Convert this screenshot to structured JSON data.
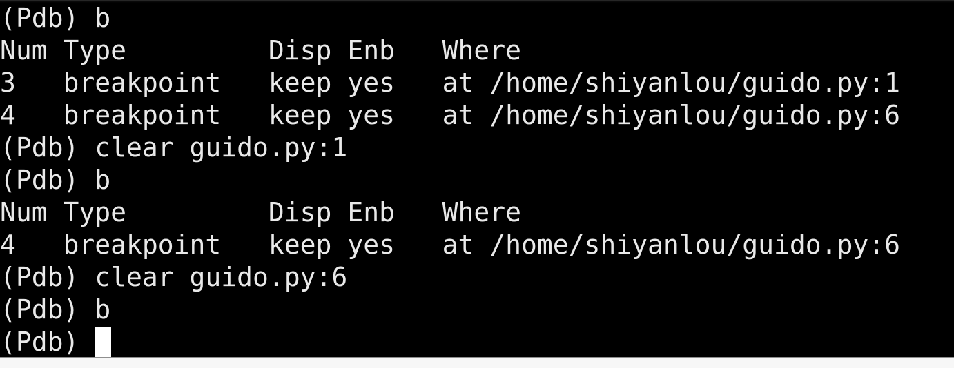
{
  "terminal": {
    "title": "Pdb debugger session",
    "background_color": "#000000",
    "foreground_color": "#e9e9e9",
    "cursor_color": "#ffffff",
    "bottom_bar_color": "#f7f7f7",
    "prompt": "(Pdb) ",
    "cursor": {
      "shape": "block",
      "visible": true,
      "line_index": 10,
      "column": 6
    },
    "lines": [
      {
        "id": "line-1",
        "text": "(Pdb) b",
        "type": "prompt"
      },
      {
        "id": "line-2",
        "text": "Num Type         Disp Enb   Where",
        "type": "header"
      },
      {
        "id": "line-3",
        "text": "3   breakpoint   keep yes   at /home/shiyanlou/guido.py:1",
        "type": "breakpoint"
      },
      {
        "id": "line-4",
        "text": "4   breakpoint   keep yes   at /home/shiyanlou/guido.py:6",
        "type": "breakpoint"
      },
      {
        "id": "line-5",
        "text": "(Pdb) clear guido.py:1",
        "type": "prompt"
      },
      {
        "id": "line-6",
        "text": "(Pdb) b",
        "type": "prompt"
      },
      {
        "id": "line-7",
        "text": "Num Type         Disp Enb   Where",
        "type": "header"
      },
      {
        "id": "line-8",
        "text": "4   breakpoint   keep yes   at /home/shiyanlou/guido.py:6",
        "type": "breakpoint"
      },
      {
        "id": "line-9",
        "text": "(Pdb) clear guido.py:6",
        "type": "prompt"
      },
      {
        "id": "line-10",
        "text": "(Pdb) b",
        "type": "prompt"
      },
      {
        "id": "line-11",
        "text": "(Pdb) ",
        "type": "prompt-cursor"
      }
    ],
    "breakpoint_table": {
      "columns": [
        "Num",
        "Type",
        "Disp",
        "Enb",
        "Where"
      ],
      "listings": [
        {
          "rows": [
            {
              "num": "3",
              "type": "breakpoint",
              "disp": "keep",
              "enb": "yes",
              "where": "at /home/shiyanlou/guido.py:1"
            },
            {
              "num": "4",
              "type": "breakpoint",
              "disp": "keep",
              "enb": "yes",
              "where": "at /home/shiyanlou/guido.py:6"
            }
          ]
        },
        {
          "rows": [
            {
              "num": "4",
              "type": "breakpoint",
              "disp": "keep",
              "enb": "yes",
              "where": "at /home/shiyanlou/guido.py:6"
            }
          ]
        }
      ]
    },
    "commands_entered": [
      "b",
      "clear guido.py:1",
      "b",
      "clear guido.py:6",
      "b"
    ]
  }
}
